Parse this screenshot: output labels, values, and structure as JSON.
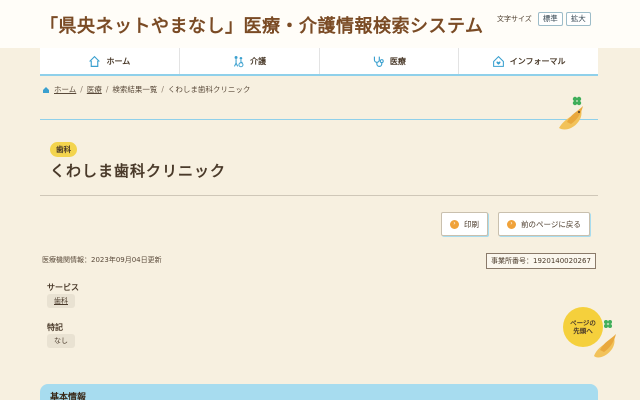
{
  "header": {
    "site_title": "「県央ネットやまなし」医療・介護情報検索システム",
    "font_size_label": "文字サイズ",
    "font_size_normal": "標準",
    "font_size_large": "拡大"
  },
  "nav": {
    "items": [
      {
        "label": "ホーム",
        "icon": "home-icon"
      },
      {
        "label": "介護",
        "icon": "care-icon"
      },
      {
        "label": "医療",
        "icon": "stethoscope-icon"
      },
      {
        "label": "インフォーマル",
        "icon": "house-heart-icon"
      }
    ]
  },
  "breadcrumb": {
    "home": "ホーム",
    "medical": "医療",
    "results": "検索結果一覧",
    "current": "くわしま歯科クリニック",
    "separator": "/"
  },
  "clinic": {
    "category_tag": "歯科",
    "name": "くわしま歯科クリニック"
  },
  "actions": {
    "print": "印刷",
    "back": "前のページに戻る"
  },
  "info": {
    "updated": "医療機関情報：2023年09月04日更新",
    "business_no": "事業所番号：1920140020267"
  },
  "details": {
    "service_label": "サービス",
    "service_value": "歯科",
    "feature_label": "特記",
    "feature_value": "なし"
  },
  "page_top": {
    "line1": "ページの",
    "line2": "先頭へ"
  },
  "section": {
    "basic_info": "基本情報"
  },
  "colors": {
    "background": "#f7f0e0",
    "accent_blue": "#a7dcef",
    "accent_yellow": "#f3d44e",
    "title_brown": "#7a4b25",
    "button_orange": "#f0a23a"
  }
}
